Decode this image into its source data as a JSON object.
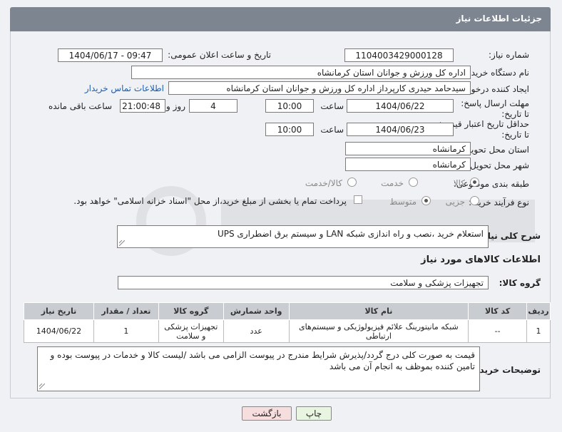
{
  "header": {
    "title": "جزئیات اطلاعات نیاز"
  },
  "fields": {
    "need_number_label": "شماره نیاز:",
    "need_number": "1104003429000128",
    "announce_label": "تاریخ و ساعت اعلان عمومی:",
    "announce_value": "1404/06/17 - 09:47",
    "buyer_org_label": "نام دستگاه خریدار:",
    "buyer_org": "اداره کل ورزش و جوانان استان کرمانشاه",
    "creator_label": "ایجاد کننده درخواست:",
    "creator": "سیدحامد حیدری کارپرداز اداره کل ورزش و جوانان استان کرمانشاه",
    "contact_link": "اطلاعات تماس خریدار",
    "deadline_label": "مهلت ارسال پاسخ: تا تاریخ:",
    "deadline_date": "1404/06/22",
    "time_label": "ساعت",
    "deadline_time": "10:00",
    "days_value": "4",
    "days_label": "روز و",
    "remaining_time": "21:00:48",
    "remaining_label": "ساعت باقی مانده",
    "validity_label": "حداقل تاریخ اعتبار قیمت: تا تاریخ:",
    "validity_date": "1404/06/23",
    "validity_time": "10:00",
    "province_label": "استان محل تحویل:",
    "province": "کرمانشاه",
    "city_label": "شهر محل تحویل:",
    "city": "کرمانشاه",
    "category_label": "طبقه بندی موضوعی:",
    "category_options": [
      "کالا",
      "خدمت",
      "کالا/خدمت"
    ],
    "process_label": "نوع فرآیند خرید :",
    "process_options": [
      "جزیی",
      "متوسط"
    ],
    "payment_note": "پرداخت تمام یا بخشی از مبلغ خرید،از محل \"اسناد خزانه اسلامی\" خواهد بود."
  },
  "description": {
    "label": "شرح کلی نیاز:",
    "value": "استعلام خرید ،نصب و راه اندازی شبکه LAN و سیستم برق اضطراری UPS"
  },
  "goods": {
    "section_title": "اطلاعات کالاهای مورد نیاز",
    "group_label": "گروه کالا:",
    "group_value": "تجهیزات پزشکی و سلامت",
    "columns": [
      "ردیف",
      "کد کالا",
      "نام کالا",
      "واحد شمارش",
      "گروه کالا",
      "تعداد / مقدار",
      "تاریخ نیاز"
    ],
    "rows": [
      [
        "1",
        "--",
        "شبکه مانیتورینگ علائم فیزیولوژیکی و سیستم‌های ارتباطی",
        "عدد",
        "تجهیزات پزشکی و سلامت",
        "1",
        "1404/06/22"
      ]
    ]
  },
  "buyer_notes": {
    "label": "توضیحات خریدار:",
    "value": "قیمت به صورت کلی درج گردد/پذیرش شرایط مندرج در پیوست الزامی می باشد /لیست کالا و خدمات در پیوست بوده و تامین کننده بموظف به انجام آن می باشد"
  },
  "buttons": {
    "print": "چاپ",
    "back": "بازگشت"
  },
  "colors": {
    "title_bar": "#7d8590",
    "table_header": "#c9ccd1",
    "back_button": "#f7dede",
    "print_button": "#e8f5e0"
  }
}
